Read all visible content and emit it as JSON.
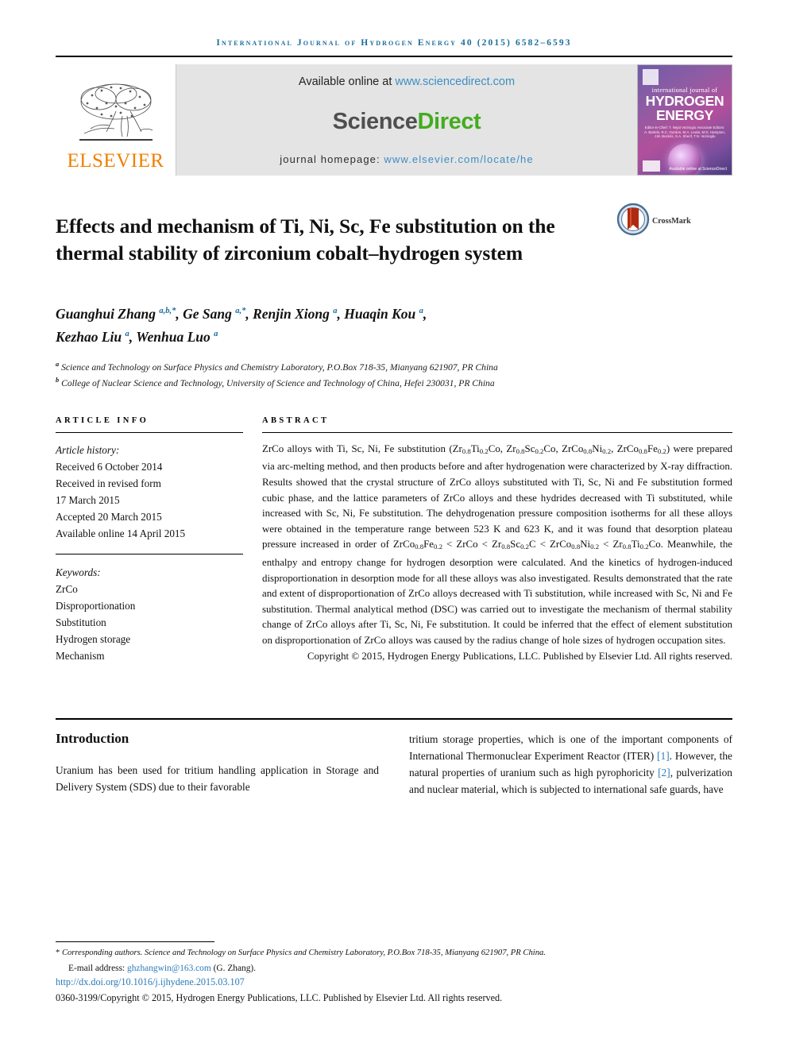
{
  "running_head": "International Journal of Hydrogen Energy 40 (2015) 6582–6593",
  "masthead": {
    "publisher_name": "ELSEVIER",
    "available_prefix": "Available online at ",
    "available_url": "www.sciencedirect.com",
    "sciencedirect_part1": "Science",
    "sciencedirect_part2": "Direct",
    "homepage_prefix": "journal homepage: ",
    "homepage_url": "www.elsevier.com/locate/he",
    "cover": {
      "small_title": "international journal of",
      "big_title_line1": "HYDROGEN",
      "big_title_line2": "ENERGY",
      "editors": "Editor-in-Chief: T. Nejat Veziroglu    Associate Editors: A. Bartels, R.C. Gordon, M.A. Lewis, M.D. Hampton, J.M. Bockris, S.A. Sherif, T.N. Veziroglu",
      "sciencedirect_mark": "Available online at ScienceDirect"
    }
  },
  "title": "Effects and mechanism of Ti, Ni, Sc, Fe substitution on the thermal stability of zirconium cobalt–hydrogen system",
  "crossmark_label": "CrossMark",
  "authors_line1": "Guanghui Zhang",
  "authors": [
    {
      "name": "Guanghui Zhang",
      "marks": "a,b,*"
    },
    {
      "name": "Ge Sang",
      "marks": "a,*"
    },
    {
      "name": "Renjin Xiong",
      "marks": "a"
    },
    {
      "name": "Huaqin Kou",
      "marks": "a"
    },
    {
      "name": "Kezhao Liu",
      "marks": "a"
    },
    {
      "name": "Wenhua Luo",
      "marks": "a"
    }
  ],
  "affiliations": [
    {
      "mark": "a",
      "text": "Science and Technology on Surface Physics and Chemistry Laboratory, P.O.Box 718-35, Mianyang 621907, PR China"
    },
    {
      "mark": "b",
      "text": "College of Nuclear Science and Technology, University of Science and Technology of China, Hefei 230031, PR China"
    }
  ],
  "article_info": {
    "heading": "ARTICLE INFO",
    "history_label": "Article history:",
    "history": [
      "Received 6 October 2014",
      "Received in revised form",
      "17 March 2015",
      "Accepted 20 March 2015",
      "Available online 14 April 2015"
    ],
    "keywords_label": "Keywords:",
    "keywords": [
      "ZrCo",
      "Disproportionation",
      "Substitution",
      "Hydrogen storage",
      "Mechanism"
    ]
  },
  "abstract": {
    "heading": "ABSTRACT",
    "body_html": "ZrCo alloys with Ti, Sc, Ni, Fe substitution (Zr<sub>0.8</sub>Ti<sub>0.2</sub>Co, Zr<sub>0.8</sub>Sc<sub>0.2</sub>Co, ZrCo<sub>0.8</sub>Ni<sub>0.2</sub>, ZrCo<sub>0.8</sub>Fe<sub>0.2</sub>) were prepared via arc-melting method, and then products before and after hydrogenation were characterized by X-ray diffraction. Results showed that the crystal structure of ZrCo alloys substituted with Ti, Sc, Ni and Fe substitution formed cubic phase, and the lattice parameters of ZrCo alloys and these hydrides decreased with Ti substituted, while increased with Sc, Ni, Fe substitution. The dehydrogenation pressure composition isotherms for all these alloys were obtained in the temperature range between 523 K and 623 K, and it was found that desorption plateau pressure increased in order of ZrCo<sub>0.8</sub>Fe<sub>0.2</sub> &lt; ZrCo &lt; Zr<sub>0.8</sub>Sc<sub>0.2</sub>C &lt; ZrCo<sub>0.8</sub>Ni<sub>0.2</sub> &lt; Zr<sub>0.8</sub>Ti<sub>0.2</sub>Co. Meanwhile, the enthalpy and entropy change for hydrogen desorption were calculated. And the kinetics of hydrogen-induced disproportionation in desorption mode for all these alloys was also investigated. Results demonstrated that the rate and extent of disproportionation of ZrCo alloys decreased with Ti substitution, while increased with Sc, Ni and Fe substitution. Thermal analytical method (DSC) was carried out to investigate the mechanism of thermal stability change of ZrCo alloys after Ti, Sc, Ni, Fe substitution. It could be inferred that the effect of element substitution on disproportionation of ZrCo alloys was caused by the radius change of hole sizes of hydrogen occupation sites.",
    "copyright": "Copyright © 2015, Hydrogen Energy Publications, LLC. Published by Elsevier Ltd. All rights reserved."
  },
  "introduction": {
    "heading": "Introduction",
    "left_column_html": "Uranium has been used for tritium handling application in Storage and Delivery System (SDS) due to their favorable",
    "right_column_html": "tritium storage properties, which is one of the important components of International Thermonuclear Experiment Reactor (ITER) <span class=\"ref\">[1]</span>. However, the natural properties of uranium such as high pyrophoricity <span class=\"ref\">[2]</span>, pulverization and nuclear material, which is subjected to international safe guards, have"
  },
  "footer": {
    "corresponding_note_html": "<span class=\"star\">*</span> Corresponding authors. Science and Technology on Surface Physics and Chemistry Laboratory, P.O.Box 718-35, Mianyang 621907, PR China.",
    "email_label": "E-mail address:",
    "email": "ghzhangwin@163.com",
    "email_attrib": "(G. Zhang).",
    "doi": "http://dx.doi.org/10.1016/j.ijhydene.2015.03.107",
    "issn_copyright": "0360-3199/Copyright © 2015, Hydrogen Energy Publications, LLC. Published by Elsevier Ltd. All rights reserved."
  },
  "colors": {
    "link_blue": "#2b7bb9",
    "running_head_blue": "#1a6d9e",
    "elsevier_orange": "#f08000",
    "sciencedirect_green": "#44ac1f",
    "banner_gray": "#e4e4e4"
  }
}
